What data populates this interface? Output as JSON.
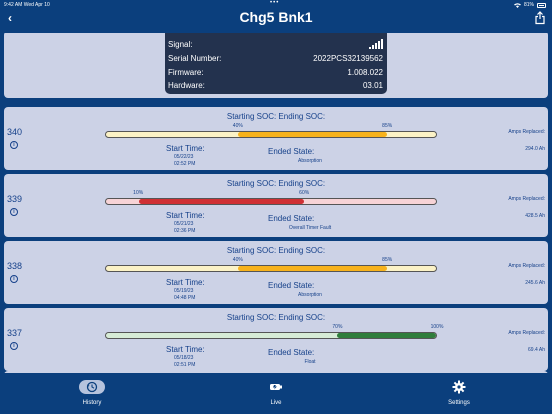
{
  "status_bar": {
    "time": "9:42 AM",
    "date": "Wed Apr 10",
    "dots": "•••",
    "battery": "81%"
  },
  "nav": {
    "title": "Chg5 Bnk1",
    "back_icon": "chevron-left-icon",
    "share_icon": "share-icon"
  },
  "info_panel": {
    "rows": [
      {
        "label": "Signal:",
        "value": ""
      },
      {
        "label": "Serial Number:",
        "value": "2022PCS32139562"
      },
      {
        "label": "Firmware:",
        "value": "1.008.022"
      },
      {
        "label": "Hardware:",
        "value": "03.01"
      }
    ],
    "signal_strength_bars": 5
  },
  "labels": {
    "soc_heading": "Starting SOC:  Ending SOC:",
    "start_time": "Start Time:",
    "ended_state": "Ended State:",
    "amps_replaced": "Amps Replaced:"
  },
  "sessions": [
    {
      "id": "340",
      "start_soc": "40%",
      "end_soc": "85%",
      "start_soc_value": 40,
      "end_soc_value": 85,
      "date": "05/22/23",
      "time": "02:52 PM",
      "ended_state": "Absorption",
      "amps": "294.0 Ah",
      "track_color": "#fbf2c6",
      "fill_color": "#f7b21c"
    },
    {
      "id": "339",
      "start_soc": "10%",
      "end_soc": "60%",
      "start_soc_value": 10,
      "end_soc_value": 60,
      "date": "05/21/23",
      "time": "02:36 PM",
      "ended_state": "Overall Timer Fault",
      "amps": "428.5 Ah",
      "track_color": "#f7d3d6",
      "fill_color": "#cf3034"
    },
    {
      "id": "338",
      "start_soc": "40%",
      "end_soc": "85%",
      "start_soc_value": 40,
      "end_soc_value": 85,
      "date": "05/19/23",
      "time": "04:48 PM",
      "ended_state": "Absorption",
      "amps": "245.6 Ah",
      "track_color": "#fbf2c6",
      "fill_color": "#f7b21c"
    },
    {
      "id": "337",
      "start_soc": "70%",
      "end_soc": "100%",
      "start_soc_value": 70,
      "end_soc_value": 100,
      "date": "05/18/23",
      "time": "02:51 PM",
      "ended_state": "Float",
      "amps": "69.4 Ah",
      "track_color": "#d7ecd6",
      "fill_color": "#2f7d3b"
    }
  ],
  "tabs": [
    {
      "label": "History",
      "icon": "history-icon",
      "active": true
    },
    {
      "label": "Live",
      "icon": "battery-plug-icon",
      "active": false
    },
    {
      "label": "Settings",
      "icon": "gear-icon",
      "active": false
    }
  ],
  "colors": {
    "nav_background": "#0b3f7d",
    "card_background": "#ccd2e6",
    "info_panel_background": "#23324e",
    "text_blue": "#16418a"
  }
}
